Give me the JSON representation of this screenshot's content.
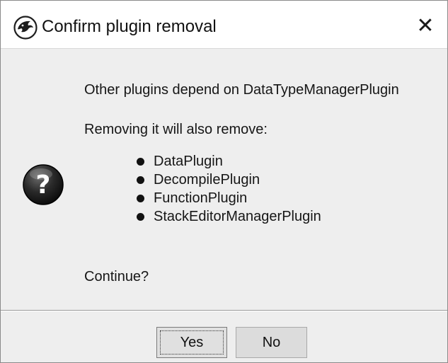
{
  "window": {
    "title": "Confirm plugin removal",
    "close_glyph": "✕",
    "app_icon": "ghidra-dragon-icon"
  },
  "message": {
    "line1": "Other plugins depend on DataTypeManagerPlugin",
    "line2": "Removing it will also remove:",
    "plugins": [
      "DataPlugin",
      "DecompilePlugin",
      "FunctionPlugin",
      "StackEditorManagerPlugin"
    ],
    "continue": "Continue?",
    "icon": "question-icon"
  },
  "buttons": {
    "yes": "Yes",
    "no": "No"
  },
  "colors": {
    "title_bar_bg": "#ffffff",
    "dialog_bg": "#eeeeee",
    "button_bg": "#dcdcdc",
    "icon_dark": "#222222"
  }
}
